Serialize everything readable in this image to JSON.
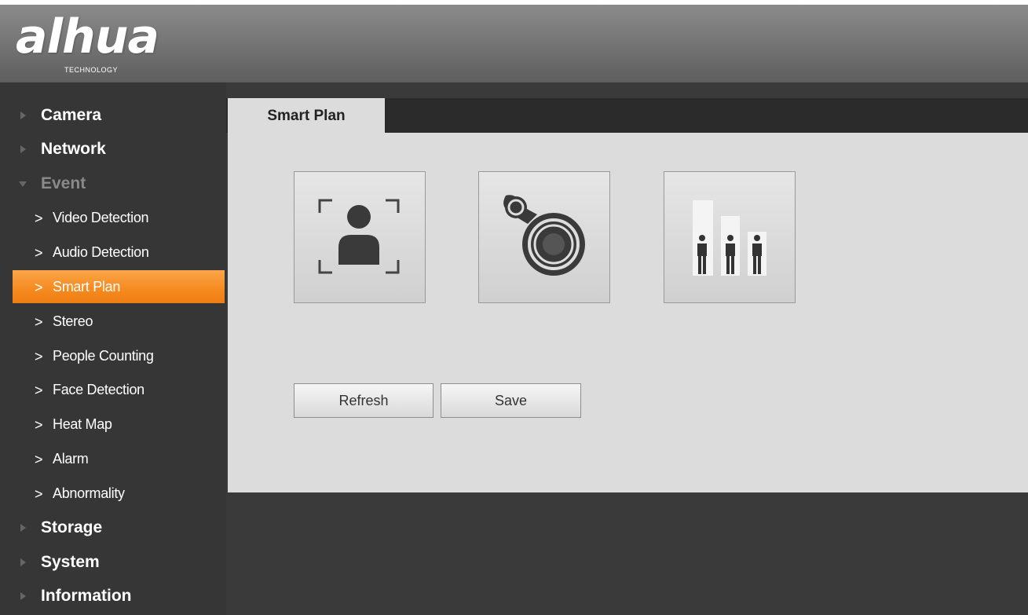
{
  "header": {
    "logo_text": "alhua",
    "logo_subtext": "TECHNOLOGY"
  },
  "sidebar": {
    "items": [
      {
        "label": "Camera",
        "level": 1
      },
      {
        "label": "Network",
        "level": 1
      },
      {
        "label": "Event",
        "level": 1,
        "expanded": true
      },
      {
        "label": "Video Detection",
        "level": 2
      },
      {
        "label": "Audio Detection",
        "level": 2
      },
      {
        "label": "Smart Plan",
        "level": 2,
        "active": true
      },
      {
        "label": "Stereo",
        "level": 2
      },
      {
        "label": "People Counting",
        "level": 2
      },
      {
        "label": "Face Detection",
        "level": 2
      },
      {
        "label": "Heat Map",
        "level": 2
      },
      {
        "label": "Alarm",
        "level": 2
      },
      {
        "label": "Abnormality",
        "level": 2
      },
      {
        "label": "Storage",
        "level": 1
      },
      {
        "label": "System",
        "level": 1
      },
      {
        "label": "Information",
        "level": 1
      }
    ],
    "chevron_glyph": ">"
  },
  "main": {
    "tab_label": "Smart Plan",
    "tiles": [
      {
        "icon": "face-detection-icon"
      },
      {
        "icon": "heat-map-icon"
      },
      {
        "icon": "people-counting-icon"
      }
    ],
    "buttons": {
      "refresh_label": "Refresh",
      "save_label": "Save"
    }
  },
  "colors": {
    "active_item": "#f58a1f",
    "sidebar_bg": "#363636",
    "panel_bg": "#dcdcdc",
    "header_bg": "#777777"
  }
}
